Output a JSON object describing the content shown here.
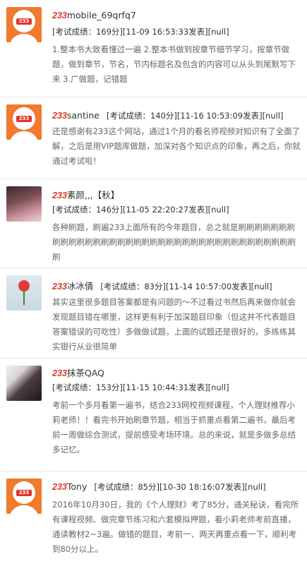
{
  "brand_prefix": "233",
  "colors": {
    "brand_orange": "#f07a2d",
    "brand_red": "#e2342b",
    "divider": "#e6e6e6",
    "text": "#333333",
    "muted": "#666666"
  },
  "comments": [
    {
      "username": "mobile_69qrfq7",
      "score": "[考试成绩：169分][11-09 16:53:33发表][null]",
      "content": "1.整本书大致看懂过一遍 2.整本书做到按章节细节学习，按章节做题，做到章节，节名，节内标题名及包含的内容可以从头到尾默写下来 3.广做题，记错题"
    },
    {
      "username": "santine",
      "score": "[考试成绩：140分][11-16 10:53:09发表][null]",
      "content": "还是感谢有233这个网站，通过1个月的看名师视频对知识有了全面了解，之后是用VIP题库做题，加深对各个知识点的印象，再之后，你就通过考试啦！"
    },
    {
      "username": "素颜,,,【秋】",
      "score": "[考试成绩：146分][11-05 22:20:27发表][null]",
      "content": "各种刷题，刷遍233上面所有的今年题目，总之就是刷刷刷刷刷刷刷刷刷刷刷刷刷刷刷刷刷刷刷刷刷刷刷刷刷刷刷刷刷刷刷刷刷刷刷刷刷刷"
    },
    {
      "username": "冰冰倩",
      "score": "[考试成绩：83分][11-14 10:57:00发表][null]",
      "content": "其实这里很多题目答案都是有问题的～不过看过书然后再来做你就会发现题目错在哪里，这样更有利于加深题目印象（但这并不代表题目答案错误的可吃性）多做做试题，上面的试题还是很好的，多练练其实银行从业很简单"
    },
    {
      "username": "抹茶QAQ",
      "score": "[考试成绩：153分][11-15 10:44:31发表][null]",
      "content": "考前一个多月看第一遍书，结合233网校视频课程，个人理财推荐小莉老师！！看完书开始刷章节题，相当于抓重点看第二遍书，最后考前一周做综合测试，提前感受考场环境。总的来说，就是多做多总结多记忆。"
    },
    {
      "username": "Tony",
      "score": "[考试成绩：85分][10-30 18:16:07发表][null]",
      "content": "2016年10月30日，我的《个人理财》考了85分，通关秘诀，看完所有课程视频、做完章节练习和六套模拟押题，看小莉老师考前直播，通读教材2~3遍。做错的题目，考前一、两天再重点看一下，顺利考到80分以上。"
    }
  ]
}
